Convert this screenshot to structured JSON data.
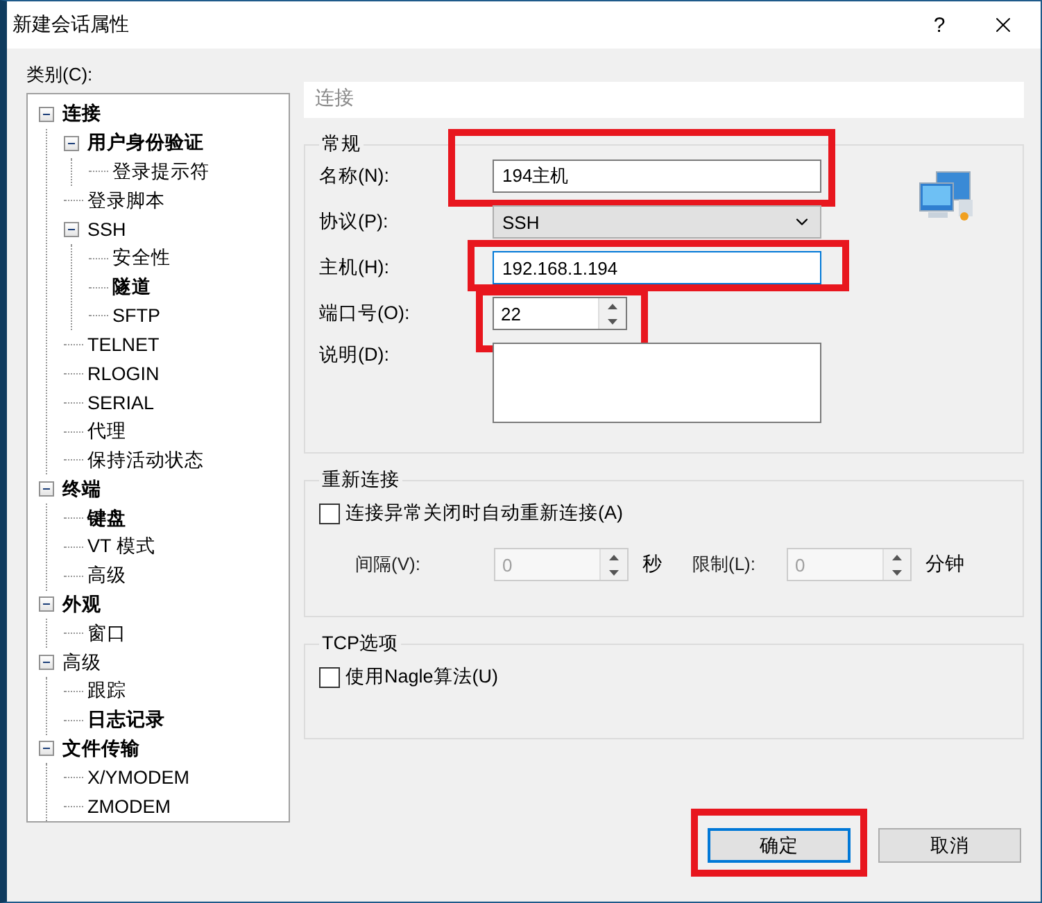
{
  "window": {
    "title": "新建会话属性",
    "help": "?"
  },
  "category_label": "类别(C):",
  "tree": [
    {
      "label": "连接",
      "bold": true,
      "expanded": true,
      "children": [
        {
          "label": "用户身份验证",
          "bold": true,
          "expanded": true,
          "children": [
            {
              "label": "登录提示符",
              "bold": false
            }
          ]
        },
        {
          "label": "登录脚本",
          "bold": false
        },
        {
          "label": "SSH",
          "bold": false,
          "expanded": true,
          "children": [
            {
              "label": "安全性",
              "bold": false
            },
            {
              "label": "隧道",
              "bold": true
            },
            {
              "label": "SFTP",
              "bold": false
            }
          ]
        },
        {
          "label": "TELNET",
          "bold": false
        },
        {
          "label": "RLOGIN",
          "bold": false
        },
        {
          "label": "SERIAL",
          "bold": false
        },
        {
          "label": "代理",
          "bold": false
        },
        {
          "label": "保持活动状态",
          "bold": false
        }
      ]
    },
    {
      "label": "终端",
      "bold": true,
      "expanded": true,
      "children": [
        {
          "label": "键盘",
          "bold": true
        },
        {
          "label": "VT 模式",
          "bold": false
        },
        {
          "label": "高级",
          "bold": false
        }
      ]
    },
    {
      "label": "外观",
      "bold": true,
      "expanded": true,
      "children": [
        {
          "label": "窗口",
          "bold": false
        }
      ]
    },
    {
      "label": "高级",
      "bold": false,
      "expanded": true,
      "children": [
        {
          "label": "跟踪",
          "bold": false
        },
        {
          "label": "日志记录",
          "bold": true
        }
      ]
    },
    {
      "label": "文件传输",
      "bold": true,
      "expanded": true,
      "children": [
        {
          "label": "X/YMODEM",
          "bold": false
        },
        {
          "label": "ZMODEM",
          "bold": false
        }
      ]
    }
  ],
  "panel_title": "连接",
  "general": {
    "legend": "常规",
    "fields": [
      {
        "kind": "text",
        "label": "名称(N):",
        "value": "194主机",
        "focused": false,
        "highlighted": true
      },
      {
        "kind": "select",
        "label": "协议(P):",
        "value": "SSH",
        "highlighted": false
      },
      {
        "kind": "text",
        "label": "主机(H):",
        "value": "192.168.1.194",
        "focused": true,
        "highlighted": true
      },
      {
        "kind": "spin",
        "label": "端口号(O):",
        "value": "22",
        "highlighted": true
      },
      {
        "kind": "textarea",
        "label": "说明(D):",
        "highlighted": false
      }
    ]
  },
  "reconnect": {
    "legend": "重新连接",
    "checkbox": {
      "label": "连接异常关闭时自动重新连接(A)",
      "checked": false
    },
    "spinners": [
      {
        "label": "间隔(V):",
        "value": "0",
        "unit": "秒",
        "disabled": true
      },
      {
        "label": "限制(L):",
        "value": "0",
        "unit": "分钟",
        "disabled": true
      }
    ]
  },
  "tcp": {
    "legend": "TCP选项",
    "checkbox": {
      "label": "使用Nagle算法(U)",
      "checked": false
    }
  },
  "buttons": [
    {
      "label": "确定",
      "default": true,
      "highlighted": true
    },
    {
      "label": "取消",
      "default": false,
      "highlighted": false
    }
  ]
}
